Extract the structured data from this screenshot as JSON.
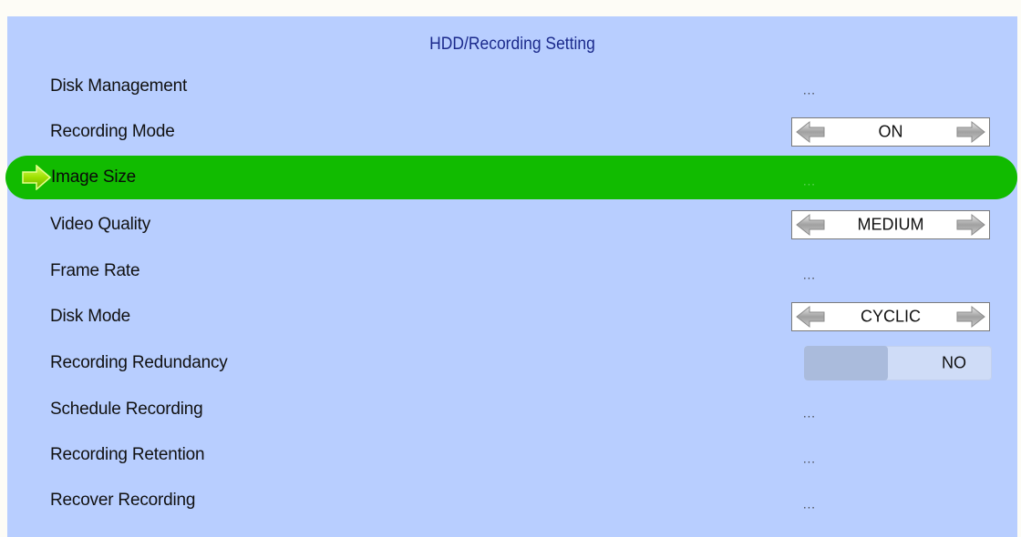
{
  "header": {
    "title": "HDD/Recording Setting"
  },
  "rows": [
    {
      "label": "Disk Management",
      "value": "..."
    },
    {
      "label": "Recording Mode",
      "value": "ON"
    },
    {
      "label": "Image Size",
      "value": "..."
    },
    {
      "label": "Video Quality",
      "value": "MEDIUM"
    },
    {
      "label": "Frame Rate",
      "value": "..."
    },
    {
      "label": "Disk Mode",
      "value": "CYCLIC"
    },
    {
      "label": "Recording Redundancy",
      "value": "NO"
    },
    {
      "label": "Schedule Recording",
      "value": "..."
    },
    {
      "label": "Recording Retention",
      "value": "..."
    },
    {
      "label": "Recover Recording",
      "value": "..."
    }
  ],
  "selected_row": "Image Size",
  "icons": {
    "selection": "arrow-right-icon",
    "spinner_prev": "arrow-left-icon",
    "spinner_next": "arrow-right-icon"
  },
  "colors": {
    "background": "#b8ceff",
    "highlight": "#11bb00",
    "title": "#1b2a8c",
    "pointer_arrow": "#9ee000"
  }
}
